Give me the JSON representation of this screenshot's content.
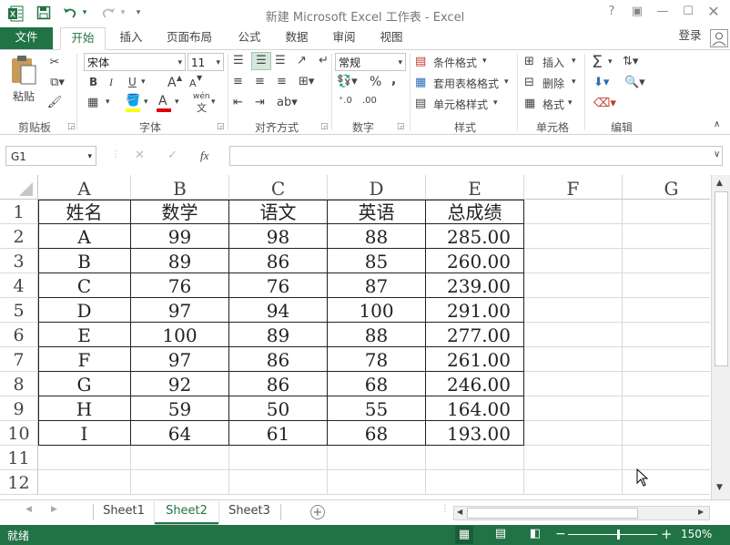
{
  "window": {
    "title": "新建 Microsoft Excel 工作表 - Excel",
    "signin": "登录"
  },
  "tabs": [
    "文件",
    "开始",
    "插入",
    "页面布局",
    "公式",
    "数据",
    "审阅",
    "视图"
  ],
  "ribbon": {
    "clipboard": {
      "paste": "粘贴",
      "label": "剪贴板"
    },
    "font": {
      "name": "宋体",
      "size": "11",
      "label": "字体",
      "bold": "B",
      "italic": "I",
      "underline": "U",
      "grow": "A",
      "shrink": "A",
      "color_letter": "A",
      "phonetic": "wén"
    },
    "alignment": {
      "label": "对齐方式"
    },
    "number": {
      "format": "常规",
      "label": "数字",
      "percent": "%",
      "comma": ","
    },
    "styles": {
      "conditional": "条件格式",
      "table": "套用表格格式",
      "cell": "单元格样式",
      "label": "样式"
    },
    "cells": {
      "insert": "插入",
      "delete": "删除",
      "format": "格式",
      "label": "单元格"
    },
    "editing": {
      "label": "编辑"
    }
  },
  "formula_bar": {
    "name_box": "G1",
    "fx": "fx",
    "value": ""
  },
  "sheet": {
    "columns": [
      "A",
      "B",
      "C",
      "D",
      "E",
      "F",
      "G"
    ],
    "rows": [
      "1",
      "2",
      "3",
      "4",
      "5",
      "6",
      "7",
      "8",
      "9",
      "10",
      "11",
      "12"
    ],
    "data": [
      [
        "姓名",
        "数学",
        "语文",
        "英语",
        "总成绩"
      ],
      [
        "A",
        "99",
        "98",
        "88",
        "285.00"
      ],
      [
        "B",
        "89",
        "86",
        "85",
        "260.00"
      ],
      [
        "C",
        "76",
        "76",
        "87",
        "239.00"
      ],
      [
        "D",
        "97",
        "94",
        "100",
        "291.00"
      ],
      [
        "E",
        "100",
        "89",
        "88",
        "277.00"
      ],
      [
        "F",
        "97",
        "86",
        "78",
        "261.00"
      ],
      [
        "G",
        "92",
        "86",
        "68",
        "246.00"
      ],
      [
        "H",
        "59",
        "50",
        "55",
        "164.00"
      ],
      [
        "I",
        "64",
        "61",
        "68",
        "193.00"
      ]
    ]
  },
  "sheet_tabs": {
    "items": [
      "Sheet1",
      "Sheet2",
      "Sheet3"
    ],
    "active": "Sheet2"
  },
  "status": {
    "ready": "就绪",
    "zoom": "150%",
    "minus": "−",
    "plus": "+"
  },
  "colors": {
    "accent": "#217346"
  }
}
